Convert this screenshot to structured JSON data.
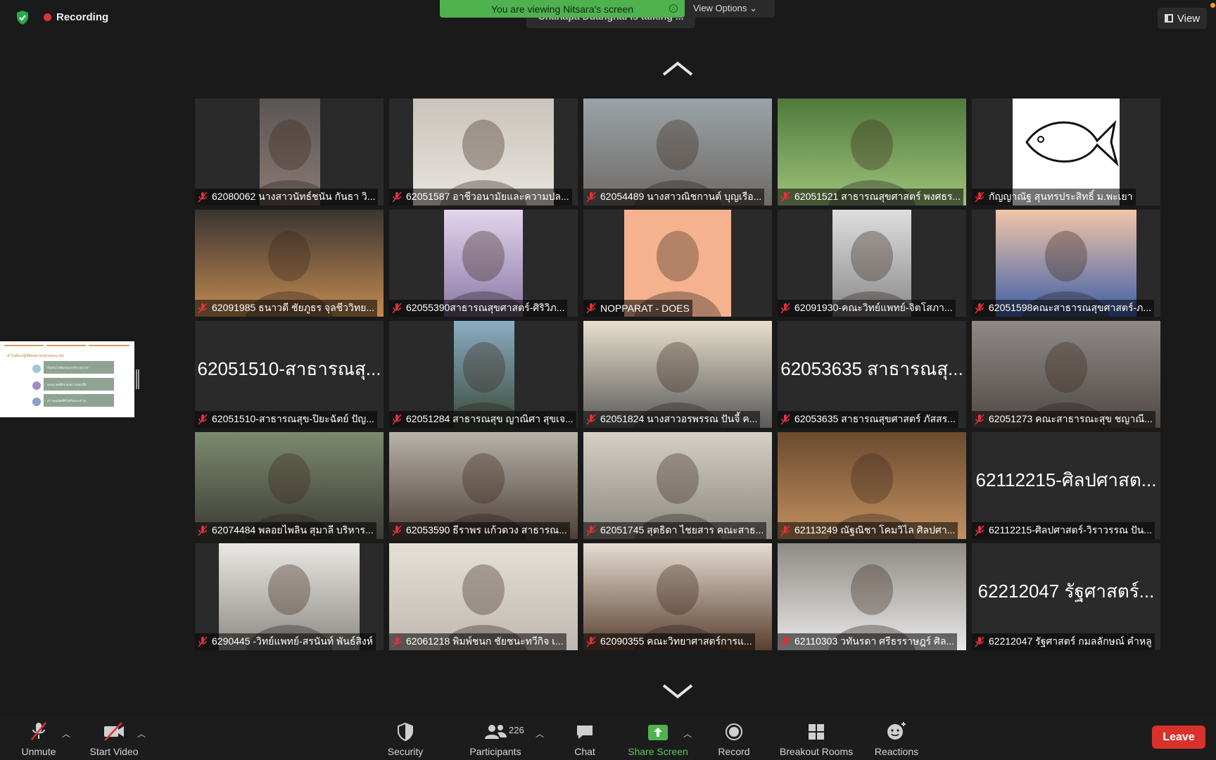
{
  "window": {
    "recording_label": "Recording",
    "viewing_banner": "You are viewing Nitsara's screen",
    "talking_indicator": "Chanapa Duangnai is talking ...",
    "view_options_label": "View Options",
    "view_button_label": "View"
  },
  "shared_screen": {
    "thumbnail_title": "ทำไมต้องปฏิบัติตนตามหลักสุขอนามัย",
    "bullets": [
      "ป้องกันโรคติดต่อและรักษาสุขภาพ",
      "สุขอนามัยที่ดีช่วยลดการแพร่เชื้อ",
      "สร้างสุขนิสัยที่ดีในชีวิตประจำวัน"
    ]
  },
  "participants": [
    {
      "name": "62080062 นางสาวนัทธ์ชนัน กันธา วิ..."
    },
    {
      "name": "62051587 อาชีวอนามัยและความปล..."
    },
    {
      "name": "62054489 นางสาวณิชกานต์ บุญเรือ..."
    },
    {
      "name": "62051521 สาธารณสุขศาสตร์ พงศธร..."
    },
    {
      "name": "กัญญาณัฐ สุนทรประสิทธิ์ ม.พะเยา"
    },
    {
      "name": "62091985 ธนาวดี ชัยภูธร จุลชีววิทย..."
    },
    {
      "name": "62055390สาธารณสุขศาสตร์-ศิริวิภ..."
    },
    {
      "name": "NOPPARAT - DOES"
    },
    {
      "name": "62091930-คณะวิทย์แพทย์-จิตโสภา..."
    },
    {
      "name": "62051598คณะสาธารณสุขศาสตร์-ภ..."
    },
    {
      "name": "62051510-สาธารณสุข-ปิยะฉัตย์ ปัญ...",
      "big": "62051510-สาธารณสุ..."
    },
    {
      "name": "62051284 สาธารณสุข ญาณิศา สุขเจ..."
    },
    {
      "name": "62051824 นางสาวอรพรรณ ปันจี้ ค..."
    },
    {
      "name": "62053635 สาธารณสุขศาสตร์ ภัสสร...",
      "big": "62053635 สาธารณสุ..."
    },
    {
      "name": "62051273 คณะสาธารณะสุข ชญาณี..."
    },
    {
      "name": "62074484 พลอยไพลิน สุมาลี บริหาร..."
    },
    {
      "name": "62053590 ธีราพร แก้วดวง สาธารณ..."
    },
    {
      "name": "62051745 สุตธิดา ไชยสาร คณะสาธ..."
    },
    {
      "name": "62113249 ณัฐณิชา โคมวิไล ศิลปศา..."
    },
    {
      "name": "62112215-ศิลปศาสตร์-วิราวรรณ ปัน...",
      "big": "62112215-ศิลปศาสต..."
    },
    {
      "name": "6290445 -วิทย์แพทย์-สรนันท์ พันธ์สิงห์"
    },
    {
      "name": "62061218 พิมพ์ชนก ชัยชนะทวีกิจ เ..."
    },
    {
      "name": "62090355 คณะวิทยาศาสตร์การแ..."
    },
    {
      "name": "62110303 วทันรดา ศรีธรราษฎร์ ศิล..."
    },
    {
      "name": "62212047 รัฐศาสตร์ กมลลักษณ์ คำหลู",
      "big": "62212047 รัฐศาสตร์..."
    }
  ],
  "toolbar": {
    "unmute_label": "Unmute",
    "start_video_label": "Start Video",
    "security_label": "Security",
    "participants_label": "Participants",
    "participants_count": "226",
    "chat_label": "Chat",
    "share_screen_label": "Share Screen",
    "record_label": "Record",
    "breakout_label": "Breakout Rooms",
    "reactions_label": "Reactions",
    "leave_label": "Leave"
  },
  "colors": {
    "share_green": "#4fb24f",
    "leave_red": "#d8312c",
    "mic_muted_red": "#e0303a",
    "recording_red": "#e0303a"
  }
}
